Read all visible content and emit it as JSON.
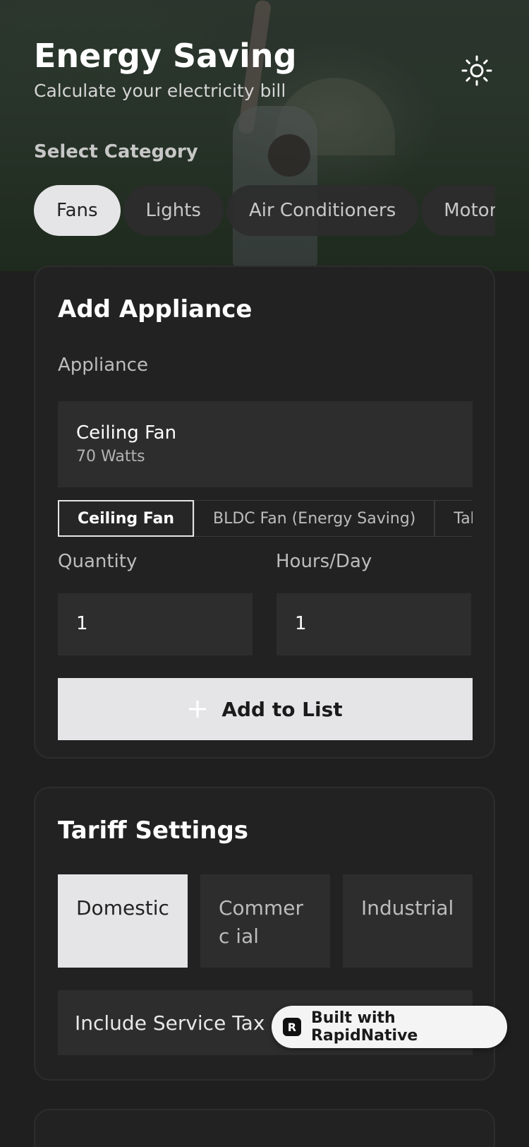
{
  "header": {
    "title": "Energy Saving",
    "subtitle": "Calculate your electricity bill",
    "theme_icon": "sun-icon"
  },
  "category": {
    "label": "Select Category",
    "items": [
      "Fans",
      "Lights",
      "Air Conditioners",
      "Motor"
    ],
    "selected": "Fans"
  },
  "add_appliance": {
    "title": "Add Appliance",
    "appliance_label": "Appliance",
    "selected_name": "Ceiling Fan",
    "selected_watts": "70 Watts",
    "types": [
      "Ceiling Fan",
      "BLDC Fan (Energy Saving)",
      "Tab"
    ],
    "quantity_label": "Quantity",
    "quantity_value": "1",
    "hours_label": "Hours/Day",
    "hours_value": "1",
    "add_button": "Add to List",
    "add_icon": "plus-icon"
  },
  "tariff": {
    "title": "Tariff Settings",
    "options": [
      "Domestic",
      "Commerc ial",
      "Industrial"
    ],
    "selected": "Domestic",
    "service_tax_label": "Include Service Tax (1"
  },
  "badge": {
    "logo_letter": "R",
    "text": "Built with RapidNative"
  },
  "colors": {
    "background": "#1f1f1f",
    "card": "#222222",
    "field": "#2d2d2d",
    "active": "#e5e5e7"
  }
}
